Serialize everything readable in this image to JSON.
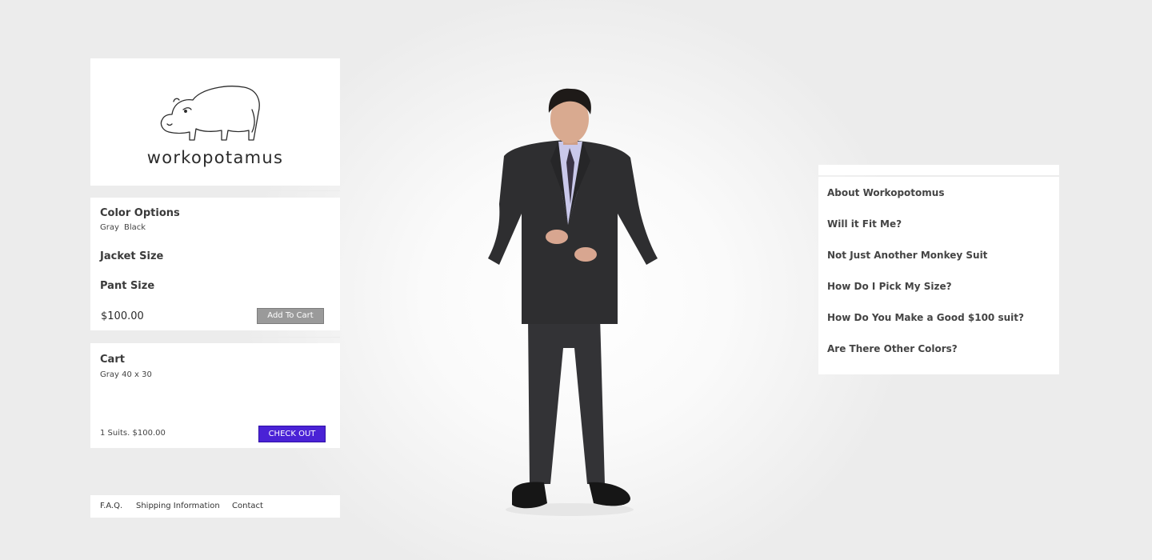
{
  "brand": {
    "name": "workopotamus"
  },
  "product": {
    "color_options_title": "Color Options",
    "colors": [
      "Gray",
      "Black"
    ],
    "jacket_size_title": "Jacket Size",
    "pant_size_title": "Pant Size",
    "price": "$100.00",
    "add_to_cart_label": "Add To Cart"
  },
  "cart": {
    "title": "Cart",
    "item": "Gray 40 x 30",
    "summary": "1 Suits. $100.00",
    "checkout_label": "CHECK OUT"
  },
  "footer": {
    "links": [
      "F.A.Q.",
      "Shipping Information",
      "Contact"
    ]
  },
  "faq": {
    "items": [
      "About Workopotomus",
      "Will it Fit Me?",
      "Not Just Another Monkey Suit",
      "How Do I Pick My Size?",
      "How Do You Make a Good $100 suit?",
      "Are There Other Colors?"
    ]
  },
  "colors": {
    "checkout_button": "#4a22d6",
    "add_button": "#9a9a9a",
    "suit": "#2e2e30",
    "shirt": "#c9c8ea"
  }
}
